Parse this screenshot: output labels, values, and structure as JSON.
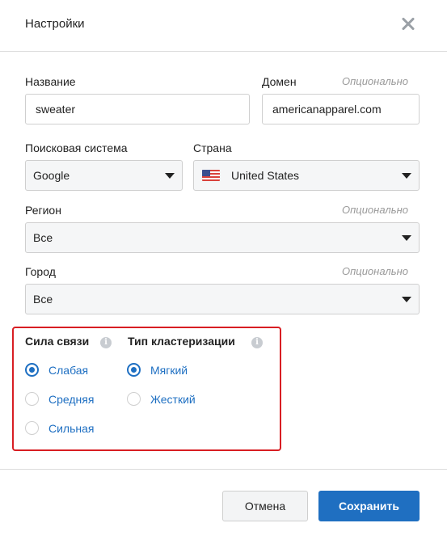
{
  "dialog": {
    "title": "Настройки"
  },
  "fields": {
    "name": {
      "label": "Название",
      "value": "sweater"
    },
    "domain": {
      "label": "Домен",
      "optional": "Опционально",
      "value": "americanapparel.com"
    },
    "search_engine": {
      "label": "Поисковая система",
      "value": "Google"
    },
    "country": {
      "label": "Страна",
      "value": "United States",
      "flag": "us-flag-icon"
    },
    "region": {
      "label": "Регион",
      "optional": "Опционально",
      "value": "Все"
    },
    "city": {
      "label": "Город",
      "optional": "Опционально",
      "value": "Все"
    }
  },
  "link_strength": {
    "title": "Сила связи",
    "info_icon": "i",
    "options": [
      {
        "label": "Слабая",
        "checked": true
      },
      {
        "label": "Средняя",
        "checked": false
      },
      {
        "label": "Сильная",
        "checked": false
      }
    ]
  },
  "clustering_type": {
    "title": "Тип кластеризации",
    "info_icon": "i",
    "options": [
      {
        "label": "Мягкий",
        "checked": true
      },
      {
        "label": "Жесткий",
        "checked": false
      }
    ]
  },
  "buttons": {
    "cancel": "Отмена",
    "save": "Сохранить"
  },
  "colors": {
    "accent": "#1f6fc1",
    "highlight_border": "#d81e23"
  }
}
